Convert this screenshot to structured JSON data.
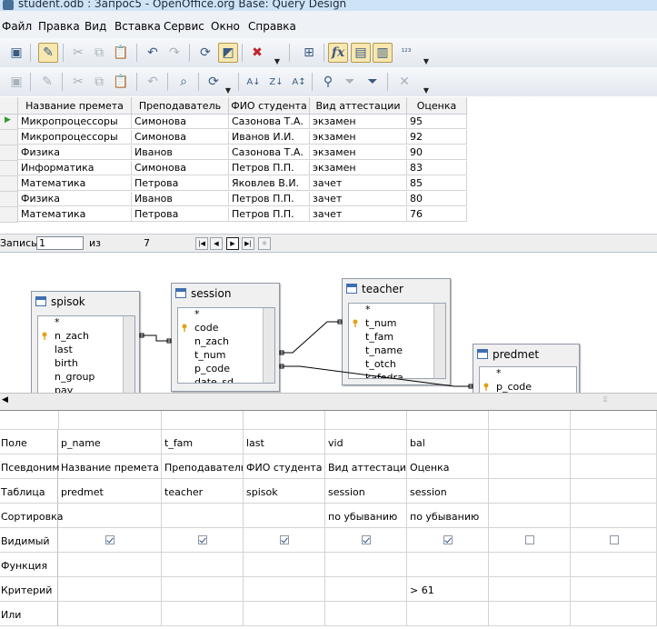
{
  "window": {
    "title": "student.odb : Запрос5 - OpenOffice.org Base: Query Design"
  },
  "menu": [
    "Файл",
    "Правка",
    "Вид",
    "Вставка",
    "Сервис",
    "Окно",
    "Справка"
  ],
  "result": {
    "columns": [
      "Название премета",
      "Преподаватель",
      "ФИО студента",
      "Вид аттестации",
      "Оценка"
    ],
    "rows": [
      [
        "Микропроцессоры",
        "Симонова",
        "Сазонова Т.А.",
        "экзамен",
        "95"
      ],
      [
        "Микропроцессоры",
        "Симонова",
        "Иванов И.И.",
        "экзамен",
        "92"
      ],
      [
        "Физика",
        "Иванов",
        "Сазонова Т.А.",
        "экзамен",
        "90"
      ],
      [
        "Информатика",
        "Симонова",
        "Петров П.П.",
        "экзамен",
        "83"
      ],
      [
        "Математика",
        "Петрова",
        "Яковлев В.И.",
        "зачет",
        "85"
      ],
      [
        "Физика",
        "Иванов",
        "Петров П.П.",
        "зачет",
        "80"
      ],
      [
        "Математика",
        "Петрова",
        "Петров П.П.",
        "зачет",
        "76"
      ]
    ]
  },
  "navigator": {
    "record_label": "Запись",
    "record_value": "1",
    "of_label": "из",
    "total": "7"
  },
  "tables": {
    "spisok": {
      "name": "spisok",
      "fields": [
        "*",
        "n_zach",
        "last",
        "birth",
        "n_group",
        "pay"
      ]
    },
    "session": {
      "name": "session",
      "fields": [
        "*",
        "code",
        "n_zach",
        "t_num",
        "p_code",
        "date_sd"
      ]
    },
    "teacher": {
      "name": "teacher",
      "fields": [
        "*",
        "t_num",
        "t_fam",
        "t_name",
        "t_otch",
        "kafedra"
      ]
    },
    "predmet": {
      "name": "predmet",
      "fields": [
        "*",
        "p_code"
      ]
    }
  },
  "criteria": {
    "row_labels": [
      "Поле",
      "Псевдоним",
      "Таблица",
      "Сортировка",
      "Видимый",
      "Функция",
      "Критерий",
      "Или"
    ],
    "columns": [
      {
        "field": "p_name",
        "alias": "Название премета",
        "table": "predmet",
        "sort": "",
        "visible": true,
        "criterion": ""
      },
      {
        "field": "t_fam",
        "alias": "Преподаватель",
        "table": "teacher",
        "sort": "",
        "visible": true,
        "criterion": ""
      },
      {
        "field": "last",
        "alias": "ФИО студента",
        "table": "spisok",
        "sort": "",
        "visible": true,
        "criterion": ""
      },
      {
        "field": "vid",
        "alias": "Вид аттестации",
        "table": "session",
        "sort": "по убыванию",
        "visible": true,
        "criterion": ""
      },
      {
        "field": "bal",
        "alias": "Оценка",
        "table": "session",
        "sort": "по убыванию",
        "visible": true,
        "criterion": "> 61"
      },
      {
        "field": "",
        "alias": "",
        "table": "",
        "sort": "",
        "visible": false,
        "criterion": ""
      },
      {
        "field": "",
        "alias": "",
        "table": "",
        "sort": "",
        "visible": false,
        "criterion": ""
      }
    ]
  },
  "colors": {
    "selection": "#f7e7b0",
    "table_icon": "#3e6fb0",
    "key_icon": "#e0a21a"
  }
}
